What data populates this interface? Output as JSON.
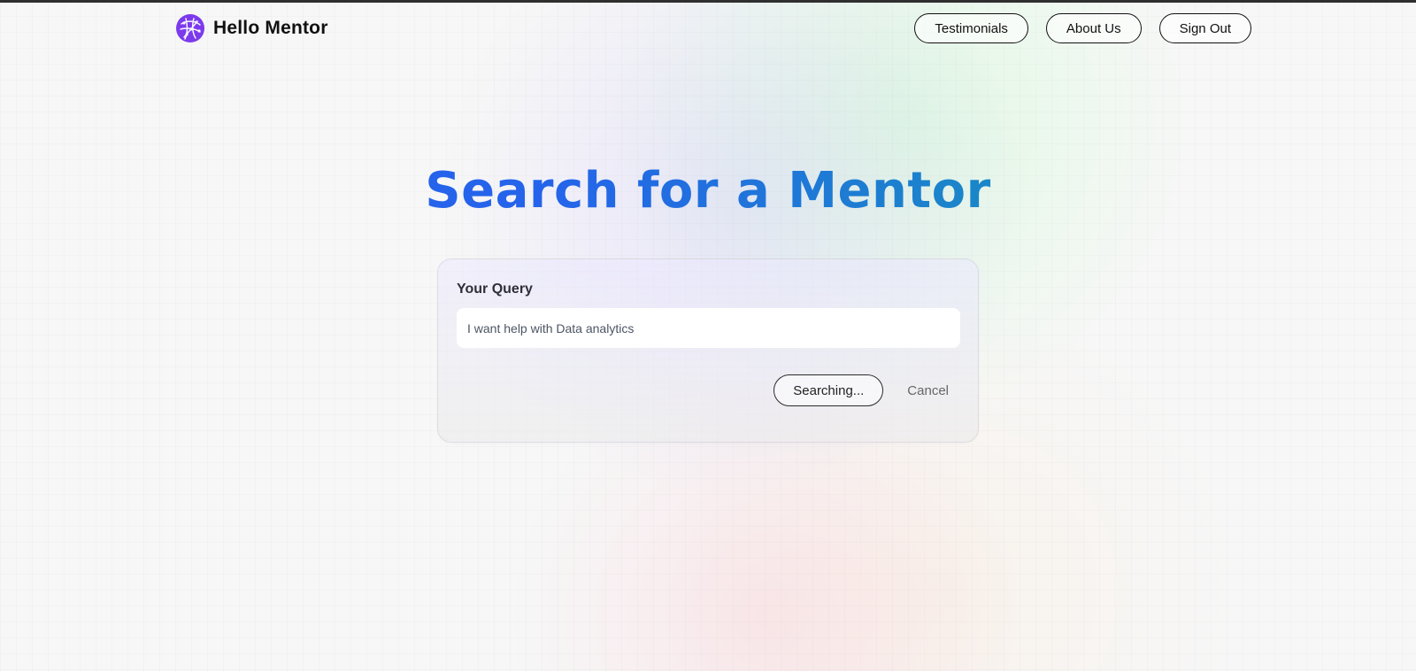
{
  "header": {
    "brand": "Hello Mentor",
    "logo_icon": "globe-network-icon",
    "nav_items": [
      {
        "label": "Testimonials"
      },
      {
        "label": "About Us"
      },
      {
        "label": "Sign Out"
      }
    ]
  },
  "main": {
    "title": "Search for a Mentor",
    "query_label": "Your Query",
    "query_value": "I want help with Data analytics",
    "searching_button": "Searching...",
    "cancel_button": "Cancel"
  },
  "colors": {
    "title_start": "#2563eb",
    "title_end": "#0891b2",
    "brand_logo": "#7c3aed"
  }
}
